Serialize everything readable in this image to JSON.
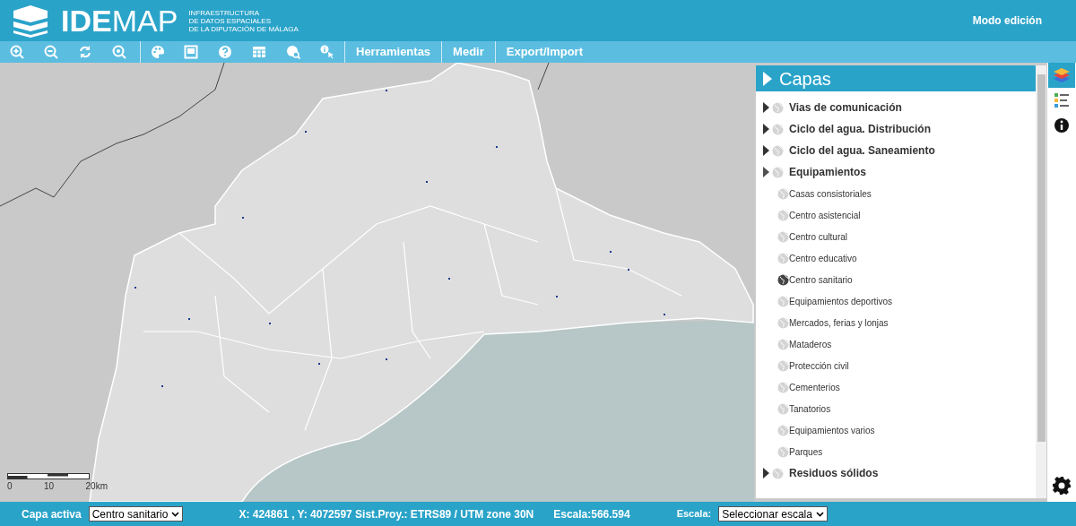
{
  "header": {
    "logo_text": "IDE",
    "logo_text_light": "MAP",
    "subtitle_lines": [
      "INFRAESTRUCTURA",
      "DE DATOS ESPACIALES",
      "DE LA DIPUTACIÓN DE MÁLAGA"
    ],
    "mode_link": "Modo edición"
  },
  "toolbar": {
    "icons": [
      {
        "kind": "zoom-in"
      },
      {
        "kind": "zoom-out"
      },
      {
        "kind": "refresh"
      },
      {
        "kind": "zoom-extent"
      },
      {
        "kind": "palette"
      },
      {
        "kind": "frame"
      },
      {
        "kind": "help"
      },
      {
        "kind": "table"
      },
      {
        "kind": "globe-search"
      },
      {
        "kind": "info-pointer"
      }
    ],
    "menus": [
      "Herramientas",
      "Medir",
      "Export/Import"
    ]
  },
  "map": {
    "scale_labels": [
      "0",
      "10",
      "20km"
    ]
  },
  "layers_panel": {
    "title": "Capas",
    "items": [
      {
        "label": "Vias de comunicación",
        "visible": false,
        "expanded": false
      },
      {
        "label": "Ciclo del agua. Distribución",
        "visible": false,
        "expanded": false
      },
      {
        "label": "Ciclo del agua. Saneamiento",
        "visible": false,
        "expanded": false
      },
      {
        "label": "Equipamientos",
        "visible": false,
        "expanded": true,
        "children": [
          {
            "label": "Casas consistoriales",
            "visible": false
          },
          {
            "label": "Centro asistencial",
            "visible": false
          },
          {
            "label": "Centro cultural",
            "visible": false
          },
          {
            "label": "Centro educativo",
            "visible": false
          },
          {
            "label": "Centro sanitario",
            "visible": true
          },
          {
            "label": "Equipamientos deportivos",
            "visible": false
          },
          {
            "label": "Mercados, ferias y lonjas",
            "visible": false
          },
          {
            "label": "Mataderos",
            "visible": false
          },
          {
            "label": "Protección civil",
            "visible": false
          },
          {
            "label": "Cementerios",
            "visible": false
          },
          {
            "label": "Tanatorios",
            "visible": false
          },
          {
            "label": "Equipamientos varios",
            "visible": false
          },
          {
            "label": "Parques",
            "visible": false
          }
        ]
      },
      {
        "label": "Residuos sólidos",
        "visible": false,
        "expanded": false
      }
    ]
  },
  "side_tabs": [
    {
      "kind": "layers",
      "selected": true
    },
    {
      "kind": "legend",
      "selected": false
    },
    {
      "kind": "info",
      "selected": false
    }
  ],
  "status_bar": {
    "active_layer_label": "Capa activa",
    "active_layer_value": "Centro sanitario",
    "coordinates": "X: 424861 , Y: 4072597 Sist.Proy.: ETRS89 / UTM zone 30N",
    "scale_reading": "Escala:566.594",
    "scale_label": "Escala:",
    "scale_select": "Seleccionar escala"
  }
}
